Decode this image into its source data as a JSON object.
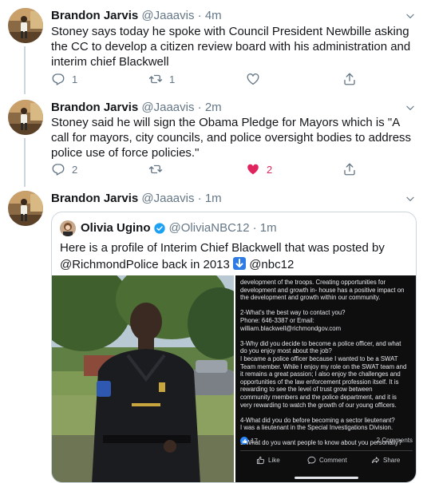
{
  "tweets": [
    {
      "name": "Brandon Jarvis",
      "handle": "@Jaaavis",
      "time": "· 4m",
      "text": "Stoney says today he spoke with Council President Newbille asking the CC to develop a citizen review board with his administration and interim chief Blackwell",
      "reply_count": "1",
      "retweet_count": "1",
      "like_count": ""
    },
    {
      "name": "Brandon Jarvis",
      "handle": "@Jaaavis",
      "time": "· 2m",
      "text": "Stoney said he will sign the Obama Pledge for Mayors which is \"A call for mayors, city councils, and police oversight bodies to address police use of force policies.\"",
      "reply_count": "2",
      "retweet_count": "",
      "like_count": "2"
    },
    {
      "name": "Brandon Jarvis",
      "handle": "@Jaaavis",
      "time": "· 1m"
    }
  ],
  "quote": {
    "name": "Olivia Ugino",
    "handle": "@OliviaNBC12",
    "time": "· 1m",
    "text_before": "Here is a profile of Interim Chief Blackwell that was posted by @RichmondPolice back in 2013",
    "text_after": "@nbc12",
    "emoji": "down-arrow-emoji",
    "post": {
      "body": "development of the troops. Creating opportunities for\ndevelopment and growth in- house has a positive impact on\nthe development and growth within our community.\n\n2-What's the best way to contact you?\nPhone: 646-3387 or Email:\nwilliam.blackwell@richmondgov.com\n\n3-Why did you decide to become a police officer, and what\ndo you enjoy most about the job?\nI became a police officer because I wanted to be a SWAT\nTeam member. While I enjoy my role on the SWAT team and\nit remains a great passion; I also enjoy the challenges and\nopportunities of the law enforcement profession itself. It is\nrewarding to see the level of trust grow between\ncommunity members and the police department, and it is\nvery rewarding to watch the growth of our young officers.\n\n4-What did you do before becoming a sector lieutenant?\nI was a lieutenant in the Special Investigations Division.\n\n5-What do you want people to know about you personally?",
      "reactions": "17",
      "comments": "2 Comments",
      "like_label": "Like",
      "comment_label": "Comment",
      "share_label": "Share"
    }
  },
  "colors": {
    "text": "#14171a",
    "secondary": "#657786",
    "like": "#e0245e",
    "border": "#ccd6dd",
    "verified": "#1da1f2"
  }
}
